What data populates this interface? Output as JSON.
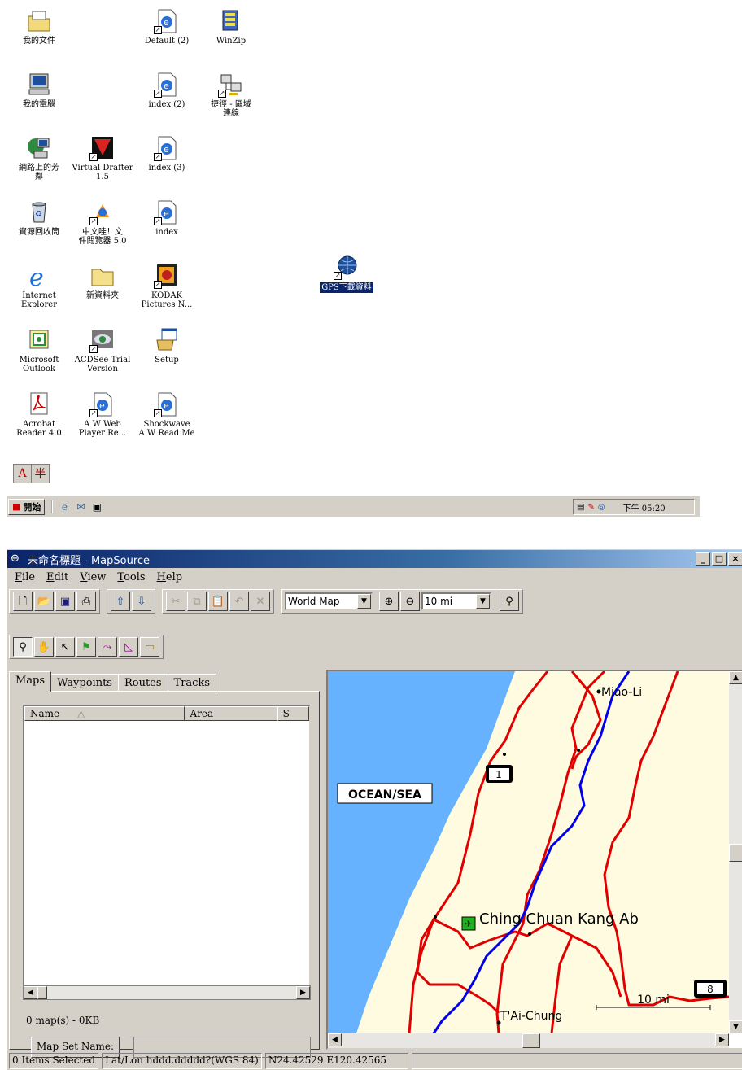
{
  "desktop": {
    "icons": {
      "my_documents": "我的文件",
      "default2": "Default (2)",
      "winzip": "WinZip",
      "my_computer": "我的電腦",
      "index2": "index (2)",
      "dialup_line1": "捷徑 - 區域",
      "dialup_line2": "連線",
      "network_line1": "網路上的芳",
      "network_line2": "鄰",
      "virtual_drafter_line1": "Virtual Drafter",
      "virtual_drafter_line2": "1.5",
      "index3": "index (3)",
      "recycle_bin": "資源回收筒",
      "cviewer_line1": "中文哇！文",
      "cviewer_line2": "件閱覽器 5.0",
      "index": "index",
      "ie_line1": "Internet",
      "ie_line2": "Explorer",
      "new_folder": "新資料夾",
      "kodak_line1": "KODAK",
      "kodak_line2": "Pictures N...",
      "gps": "GPS下載資料",
      "outlook_line1": "Microsoft",
      "outlook_line2": "Outlook",
      "acdsee_line1": "ACDSee Trial",
      "acdsee_line2": "Version",
      "setup": "Setup",
      "acrobat_line1": "Acrobat",
      "acrobat_line2": "Reader 4.0",
      "awweb_line1": "A W Web",
      "awweb_line2": "Player Re...",
      "shockwave_line1": "Shockwave",
      "shockwave_line2": "A W Read Me"
    },
    "ime": {
      "a": "A",
      "b": "半"
    },
    "taskbar": {
      "start_label": "開始",
      "clock": "下午 05:20"
    }
  },
  "window": {
    "title": "未命名標題 - MapSource",
    "menu": [
      "File",
      "Edit",
      "View",
      "Tools",
      "Help"
    ],
    "map_combo": "World Map",
    "scale_combo": "10 mi"
  },
  "left_panel": {
    "tabs": [
      "Maps",
      "Waypoints",
      "Routes",
      "Tracks"
    ],
    "columns": [
      "Name",
      "Area",
      "S"
    ],
    "map_count": "0 map(s) - 0KB",
    "map_set_button": "Map Set Name:"
  },
  "map": {
    "labels": {
      "ocean": "OCEAN/SEA",
      "miaoli": "Miao-Li",
      "ching": "Ching Chuan Kang Ab",
      "taichung": "T'Ai-Chung",
      "scale": "10 mi",
      "route1": "1",
      "route8": "8"
    },
    "colors": {
      "water": "#66b2ff",
      "land": "#fffbe1",
      "road": "#e00000",
      "river": "#0000ee"
    }
  },
  "status": {
    "selected": "0 Items Selected",
    "format": "Lat/Lon hddd.ddddd?(WGS 84)",
    "coords": "N24.42529 E120.42565"
  }
}
